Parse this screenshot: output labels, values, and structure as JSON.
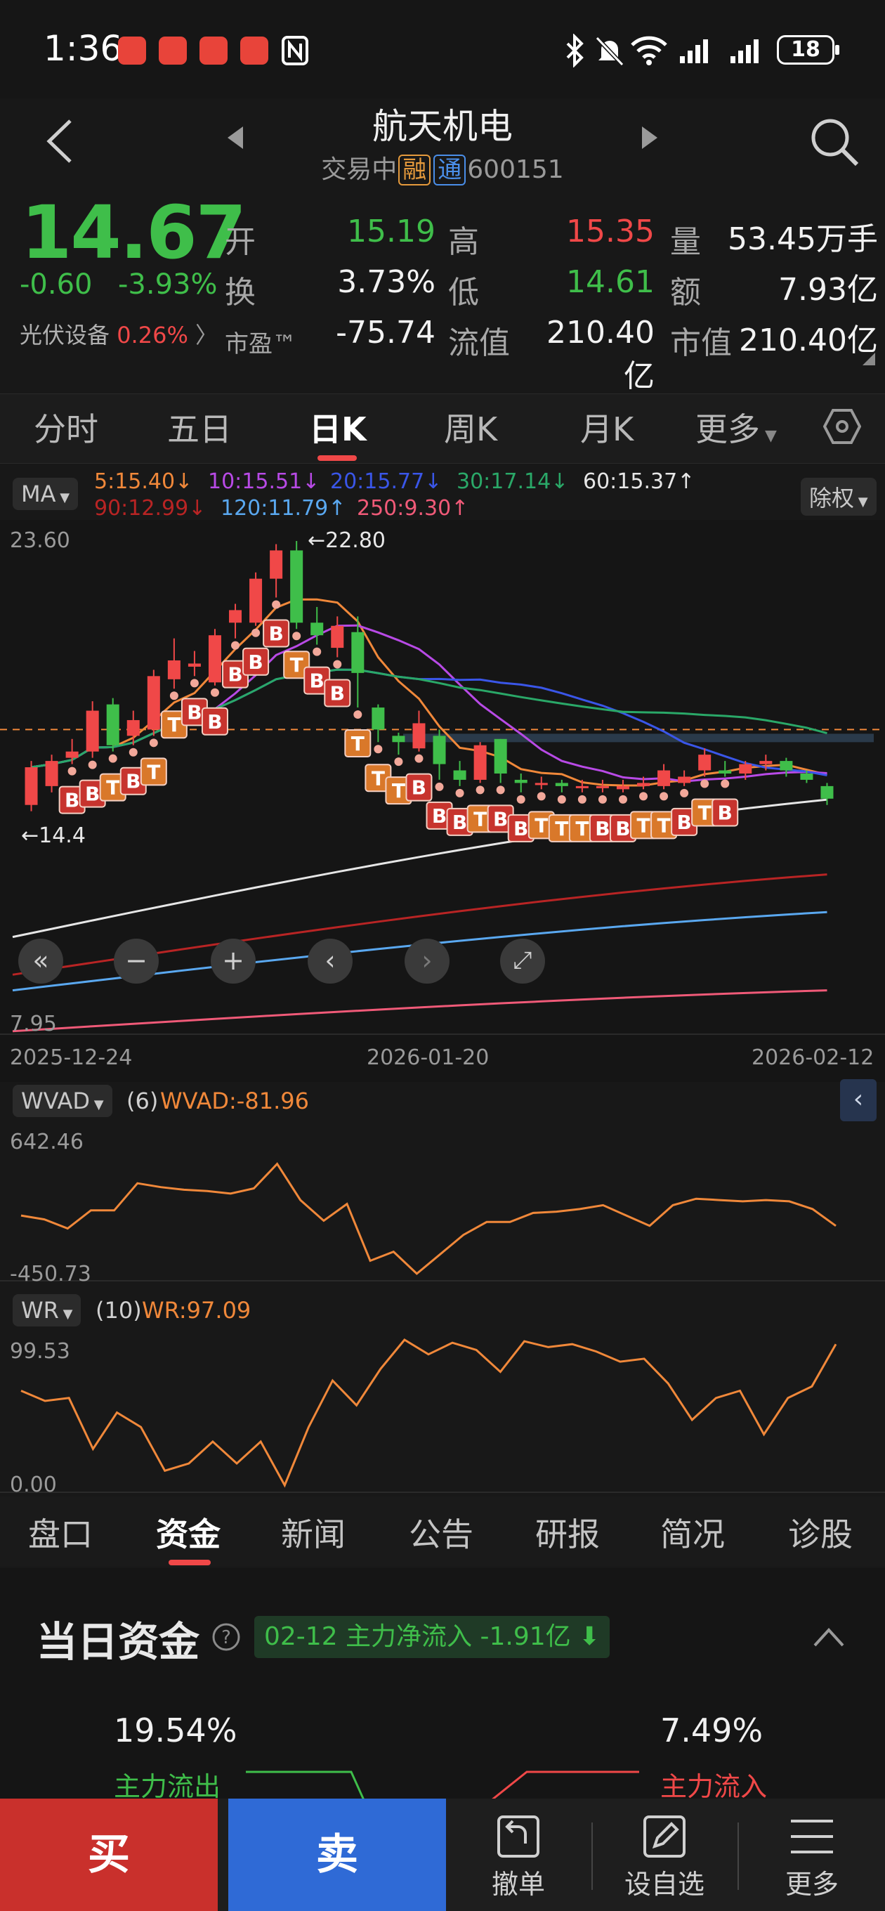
{
  "status_bar": {
    "time": "1:36",
    "battery": "18"
  },
  "header": {
    "title": "航天机电",
    "status": "交易中",
    "tag_margin": "融",
    "tag_connect": "通",
    "code": "600151"
  },
  "quote": {
    "price": "14.67",
    "change": "-0.60",
    "change_pct": "-3.93%",
    "sector_name": "光伏设备",
    "sector_pct": "0.26%",
    "fields": {
      "open_label": "开",
      "open": "15.19",
      "high_label": "高",
      "high": "15.35",
      "volume_label": "量",
      "volume": "53.45万手",
      "turnover_label": "换",
      "turnover": "3.73%",
      "low_label": "低",
      "low": "14.61",
      "amount_label": "额",
      "amount": "7.93亿",
      "pe_label": "市盈™",
      "pe": "-75.74",
      "float_cap_label": "流值",
      "float_cap": "210.40亿",
      "market_cap_label": "市值",
      "market_cap": "210.40亿"
    }
  },
  "chart_tabs": [
    "分时",
    "五日",
    "日K",
    "周K",
    "月K",
    "更多"
  ],
  "chart_tabs_active": "日K",
  "ma_legend": {
    "selector": "MA",
    "adjust": "除权",
    "ma5": "5:15.40",
    "ma10": "10:15.51",
    "ma20": "20:15.77",
    "ma30": "30:17.14",
    "ma60": "60:15.37",
    "ma90": "90:12.99",
    "ma120": "120:11.79",
    "ma250": "250:9.30"
  },
  "colors": {
    "up": "#f04848",
    "down": "#3fbe4a",
    "ma5": "#f0883a",
    "ma10": "#b84ae6",
    "ma20": "#3a56e8",
    "ma30": "#2aa868",
    "ma60": "#e6e6e6",
    "ma90": "#b82424",
    "ma120": "#5aa8f0",
    "ma250": "#f05a78",
    "buy": "#c9302c",
    "sell": "#2f6ad6"
  },
  "chart_data": [
    {
      "type": "candlestick",
      "axis_max": "23.60",
      "axis_min": "7.95",
      "annotation_high": "←22.80",
      "annotation_low": "←14.4",
      "x_ticks": [
        "2025-12-24",
        "2026-01-20",
        "2026-02-12"
      ],
      "ylim": [
        7.95,
        23.6
      ],
      "candles": [
        {
          "o": 15.2,
          "c": 16.4,
          "h": 16.6,
          "l": 15.0
        },
        {
          "o": 15.8,
          "c": 16.6,
          "h": 16.8,
          "l": 15.6
        },
        {
          "o": 16.7,
          "c": 16.9,
          "h": 17.3,
          "l": 16.5
        },
        {
          "o": 16.9,
          "c": 18.2,
          "h": 18.5,
          "l": 16.7
        },
        {
          "o": 18.4,
          "c": 17.1,
          "h": 18.6,
          "l": 16.9
        },
        {
          "o": 17.4,
          "c": 17.9,
          "h": 18.2,
          "l": 17.1
        },
        {
          "o": 17.6,
          "c": 19.3,
          "h": 19.5,
          "l": 17.4
        },
        {
          "o": 19.2,
          "c": 19.8,
          "h": 20.5,
          "l": 18.9
        },
        {
          "o": 19.6,
          "c": 19.7,
          "h": 20.1,
          "l": 19.3
        },
        {
          "o": 19.1,
          "c": 20.6,
          "h": 20.8,
          "l": 19.0
        },
        {
          "o": 21.0,
          "c": 21.4,
          "h": 21.6,
          "l": 20.5
        },
        {
          "o": 21.0,
          "c": 22.4,
          "h": 22.6,
          "l": 20.9
        },
        {
          "o": 22.4,
          "c": 23.3,
          "h": 23.5,
          "l": 21.8
        },
        {
          "o": 23.3,
          "c": 21.0,
          "h": 23.6,
          "l": 20.8
        },
        {
          "o": 21.0,
          "c": 20.6,
          "h": 21.5,
          "l": 20.3
        },
        {
          "o": 20.2,
          "c": 20.9,
          "h": 21.2,
          "l": 19.9
        },
        {
          "o": 20.7,
          "c": 19.4,
          "h": 21.2,
          "l": 18.3
        },
        {
          "o": 18.3,
          "c": 17.6,
          "h": 18.4,
          "l": 17.2
        },
        {
          "o": 17.4,
          "c": 17.2,
          "h": 17.5,
          "l": 16.8
        },
        {
          "o": 17.0,
          "c": 17.8,
          "h": 18.2,
          "l": 16.9
        },
        {
          "o": 17.4,
          "c": 16.5,
          "h": 17.6,
          "l": 16.0
        },
        {
          "o": 16.3,
          "c": 16.0,
          "h": 16.6,
          "l": 15.8
        },
        {
          "o": 16.0,
          "c": 17.1,
          "h": 17.2,
          "l": 15.9
        },
        {
          "o": 17.3,
          "c": 16.2,
          "h": 17.3,
          "l": 15.9
        },
        {
          "o": 16.0,
          "c": 15.9,
          "h": 16.2,
          "l": 15.6
        },
        {
          "o": 15.9,
          "c": 15.9,
          "h": 16.1,
          "l": 15.7
        },
        {
          "o": 15.9,
          "c": 15.8,
          "h": 16.0,
          "l": 15.6
        },
        {
          "o": 15.8,
          "c": 15.8,
          "h": 16.0,
          "l": 15.6
        },
        {
          "o": 15.8,
          "c": 15.8,
          "h": 16.0,
          "l": 15.6
        },
        {
          "o": 15.7,
          "c": 15.8,
          "h": 16.0,
          "l": 15.6
        },
        {
          "o": 15.8,
          "c": 15.9,
          "h": 16.1,
          "l": 15.7
        },
        {
          "o": 15.8,
          "c": 16.3,
          "h": 16.5,
          "l": 15.7
        },
        {
          "o": 15.9,
          "c": 16.1,
          "h": 16.3,
          "l": 15.8
        },
        {
          "o": 16.3,
          "c": 16.8,
          "h": 17.0,
          "l": 16.1
        },
        {
          "o": 16.3,
          "c": 16.2,
          "h": 16.6,
          "l": 16.1
        },
        {
          "o": 16.2,
          "c": 16.5,
          "h": 16.6,
          "l": 16.0
        },
        {
          "o": 16.5,
          "c": 16.6,
          "h": 16.8,
          "l": 16.3
        },
        {
          "o": 16.6,
          "c": 16.3,
          "h": 16.7,
          "l": 16.1
        },
        {
          "o": 16.2,
          "c": 16.0,
          "h": 16.3,
          "l": 15.9
        },
        {
          "o": 15.8,
          "c": 15.4,
          "h": 15.9,
          "l": 15.2
        }
      ]
    },
    {
      "type": "line",
      "indicator": "WVAD",
      "selector": "WVAD",
      "param": "(6)",
      "value_label": "WVAD:-81.96",
      "axis_max": "642.46",
      "axis_min": "-450.73",
      "ylim": [
        -450.73,
        642.46
      ],
      "values": [
        0,
        -30,
        -100,
        40,
        40,
        250,
        220,
        200,
        190,
        170,
        210,
        400,
        120,
        -40,
        90,
        -350,
        -280,
        -450,
        -300,
        -150,
        -50,
        -50,
        20,
        30,
        50,
        80,
        0,
        -80,
        80,
        130,
        120,
        110,
        120,
        110,
        50,
        -80
      ]
    },
    {
      "type": "line",
      "indicator": "WR",
      "selector": "WR",
      "param": "(10)",
      "value_label": "WR:97.09",
      "axis_max": "99.53",
      "axis_min": "0.00",
      "ylim": [
        0,
        99.53
      ],
      "values": [
        65,
        58,
        60,
        25,
        50,
        40,
        10,
        15,
        30,
        15,
        30,
        0,
        40,
        72,
        55,
        80,
        100,
        90,
        98,
        93,
        78,
        99,
        95,
        97,
        92,
        85,
        87,
        70,
        45,
        60,
        65,
        35,
        60,
        68,
        97
      ]
    }
  ],
  "nav_buttons": [
    "«",
    "−",
    "+",
    "‹",
    "›",
    "⤢"
  ],
  "info_tabs": [
    "盘口",
    "资金",
    "新闻",
    "公告",
    "研报",
    "简况",
    "诊股"
  ],
  "info_tabs_active": "资金",
  "capital": {
    "title": "当日资金",
    "flow_badge": "02-12 主力净流入 -1.91亿",
    "outflow_pct": "19.54%",
    "outflow_label": "主力流出",
    "inflow_pct": "7.49%",
    "inflow_label": "主力流入"
  },
  "bottom_bar": {
    "buy": "买",
    "sell": "卖",
    "cancel": "撤单",
    "add_watch": "设自选",
    "more": "更多"
  }
}
